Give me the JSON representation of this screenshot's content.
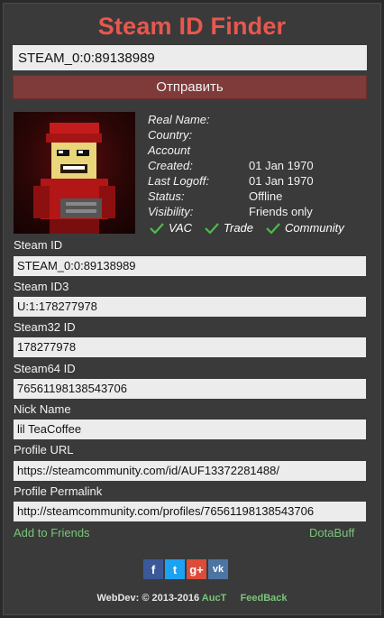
{
  "app": {
    "title": "Steam ID Finder"
  },
  "search": {
    "value": "STEAM_0:0:89138989"
  },
  "submit": {
    "label": "Отправить"
  },
  "profile": {
    "rows": [
      {
        "label": "Real Name:",
        "value": ""
      },
      {
        "label": "Country:",
        "value": ""
      },
      {
        "label": "Account",
        "value": ""
      },
      {
        "label": "Created:",
        "value": "01 Jan 1970"
      },
      {
        "label": "Last Logoff:",
        "value": "01 Jan 1970"
      },
      {
        "label": "Status:",
        "value": "Offline"
      },
      {
        "label": "Visibility:",
        "value": "Friends only"
      }
    ],
    "flags": [
      "VAC",
      "Trade",
      "Community"
    ]
  },
  "fields": [
    {
      "label": "Steam ID",
      "value": "STEAM_0:0:89138989"
    },
    {
      "label": "Steam ID3",
      "value": "U:1:178277978"
    },
    {
      "label": "Steam32 ID",
      "value": "178277978"
    },
    {
      "label": "Steam64 ID",
      "value": "76561198138543706"
    },
    {
      "label": "Nick Name",
      "value": "lil TeaCoffee"
    },
    {
      "label": "Profile URL",
      "value": "https://steamcommunity.com/id/AUF13372281488/"
    },
    {
      "label": "Profile Permalink",
      "value": "http://steamcommunity.com/profiles/76561198138543706"
    }
  ],
  "links": {
    "add_friends": "Add to Friends",
    "dotabuff": "DotaBuff"
  },
  "social": [
    {
      "name": "facebook",
      "glyph": "f",
      "color": "#3b5998"
    },
    {
      "name": "twitter",
      "glyph": "t",
      "color": "#1da1f2"
    },
    {
      "name": "google-plus",
      "glyph": "g+",
      "color": "#dd4b39"
    },
    {
      "name": "vk",
      "glyph": "vk",
      "color": "#4c75a3"
    }
  ],
  "footer": {
    "prefix": "WebDev: © 2013-2016",
    "author": "AucT",
    "feedback": "FeedBack"
  },
  "colors": {
    "accent": "#e8574f",
    "button": "#7f3a3a",
    "link": "#7bc47b"
  }
}
